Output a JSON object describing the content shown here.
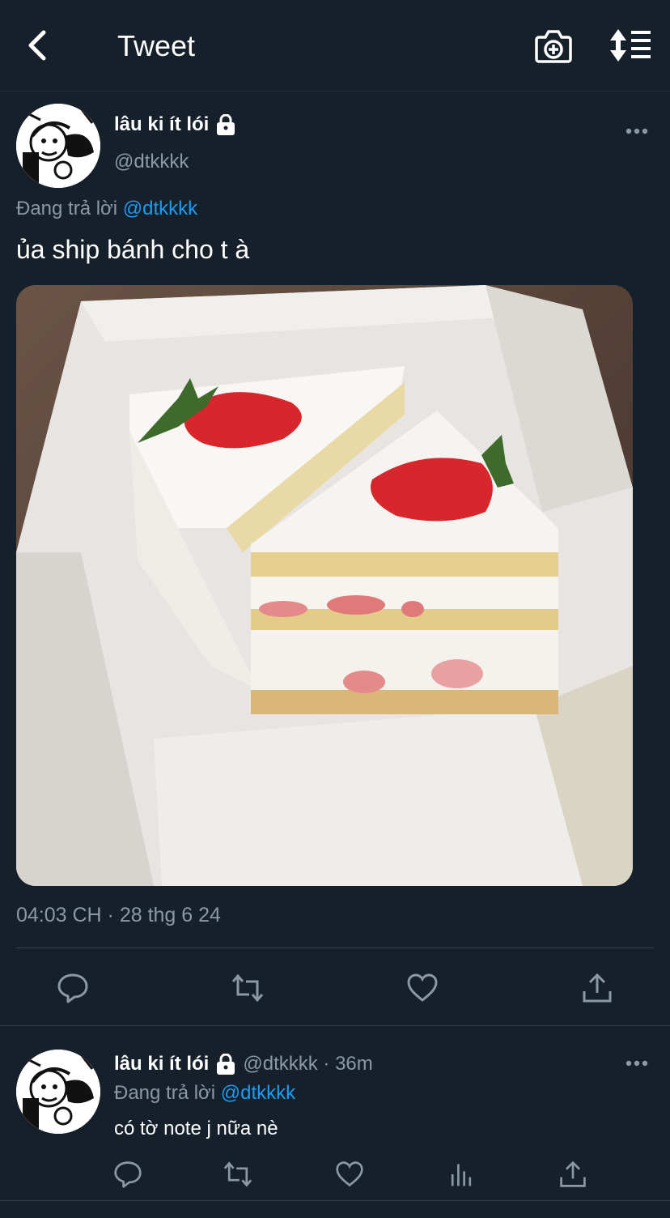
{
  "header": {
    "title": "Tweet",
    "back_icon": "chevron-left-icon",
    "camera_icon": "camera-plus-icon",
    "sort_icon": "sort-lines-icon"
  },
  "main_tweet": {
    "display_name": "lâu ki ít lói",
    "handle": "@dtkkkk",
    "replying_to_label": "Đang trả lời",
    "replying_to_handle": "@dtkkkk",
    "text": "ủa ship bánh cho t à",
    "timestamp": "04:03 CH · 28 thg 6 24",
    "actions": [
      "reply-icon",
      "retweet-icon",
      "like-icon",
      "share-icon"
    ]
  },
  "reply_tweet": {
    "display_name": "lâu ki ít lói",
    "handle_time": "@dtkkkk · 36m",
    "replying_to_label": "Đang trả lời",
    "replying_to_handle": "@dtkkkk",
    "text": "có tờ note j nữa nè",
    "actions": [
      "reply-icon",
      "retweet-icon",
      "like-icon",
      "analytics-icon",
      "share-icon"
    ]
  },
  "colors": {
    "background": "#15202b",
    "text": "#ffffff",
    "muted": "#8b98a5",
    "link": "#1d9bf0",
    "divider": "#38444d"
  }
}
